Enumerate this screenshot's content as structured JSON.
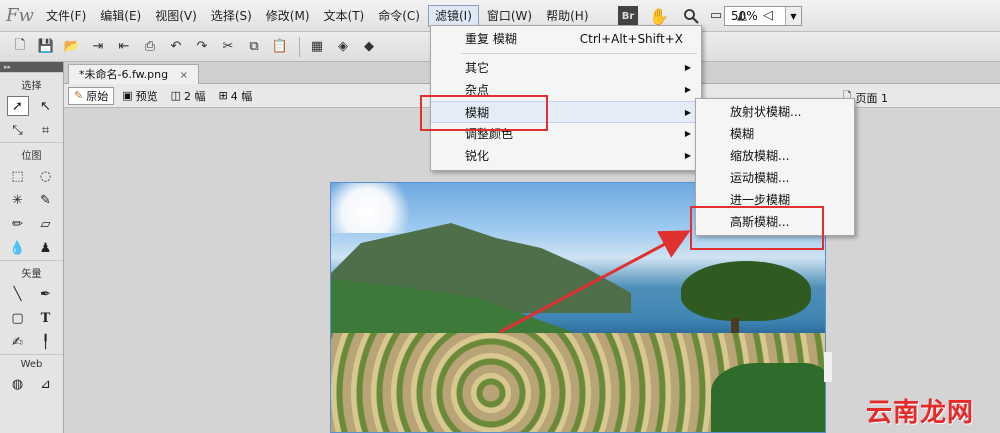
{
  "app": {
    "logo": "Fw"
  },
  "menubar": {
    "items": [
      "文件(F)",
      "编辑(E)",
      "视图(V)",
      "选择(S)",
      "修改(M)",
      "文本(T)",
      "命令(C)",
      "滤镜(I)",
      "窗口(W)",
      "帮助(H)"
    ],
    "active_index": 7,
    "bridge_label": "Br",
    "zoom_value": "50%"
  },
  "toolbar": {
    "icons": [
      "new-document-icon",
      "save-icon",
      "open-icon",
      "import-icon",
      "export-icon",
      "print-icon",
      "undo-icon",
      "redo-icon",
      "cut-icon",
      "copy-icon",
      "paste-icon"
    ]
  },
  "tools_panel": {
    "sections": [
      "选择",
      "位图",
      "矢量",
      "Web"
    ]
  },
  "document": {
    "tab_label": "*未命名-6.fw.png",
    "close_symbol": "×",
    "view_buttons": [
      "原始",
      "预览",
      "2 幅",
      "4 幅"
    ],
    "page_label": "页面 1"
  },
  "filter_menu": {
    "items": [
      {
        "label": "重复 模糊",
        "shortcut": "Ctrl+Alt+Shift+X",
        "submenu": false
      },
      {
        "label": "其它",
        "shortcut": "",
        "submenu": true
      },
      {
        "label": "杂点",
        "shortcut": "",
        "submenu": true
      },
      {
        "label": "模糊",
        "shortcut": "",
        "submenu": true
      },
      {
        "label": "调整颜色",
        "shortcut": "",
        "submenu": true
      },
      {
        "label": "锐化",
        "shortcut": "",
        "submenu": true
      }
    ]
  },
  "blur_submenu": {
    "items": [
      "放射状模糊...",
      "模糊",
      "缩放模糊...",
      "运动模糊...",
      "进一步模糊",
      "高斯模糊..."
    ]
  },
  "watermark": "云南龙网",
  "colors": {
    "highlight": "#e03030",
    "menu_hover": "#e4ecf7"
  }
}
